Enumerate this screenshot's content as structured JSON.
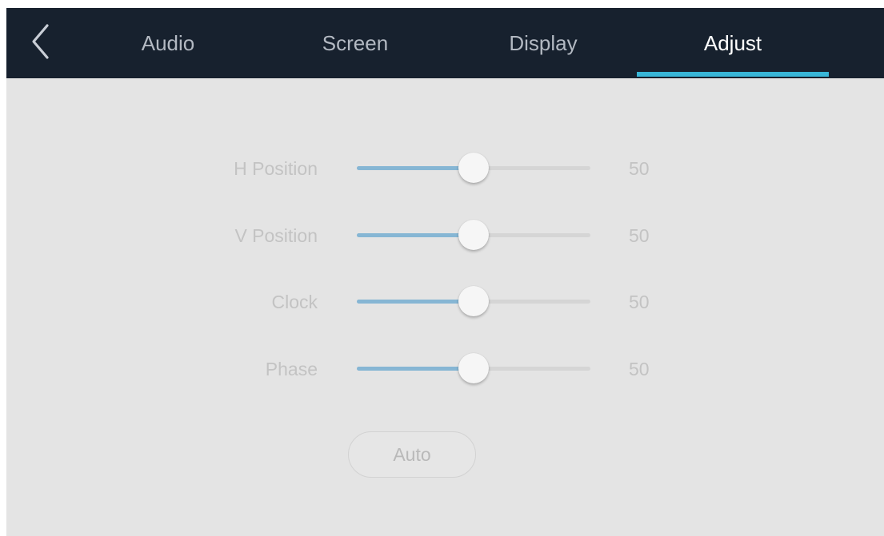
{
  "tabs": {
    "audio": "Audio",
    "screen": "Screen",
    "display": "Display",
    "adjust": "Adjust",
    "active": "Adjust"
  },
  "settings": [
    {
      "label": "H Position",
      "value": "50",
      "level": 0.5
    },
    {
      "label": "V Position",
      "value": "50",
      "level": 0.5
    },
    {
      "label": "Clock",
      "value": "50",
      "level": 0.5
    },
    {
      "label": "Phase",
      "value": "50",
      "level": 0.5
    }
  ],
  "auto_button": {
    "label": "Auto"
  },
  "icons": {
    "back": "chevron-left-icon"
  },
  "colors": {
    "header": "#17212e",
    "accent": "#38b6d8",
    "slider_fill": "#86b6d4",
    "background": "#e4e4e4"
  }
}
